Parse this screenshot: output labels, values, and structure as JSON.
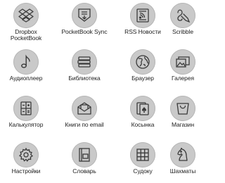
{
  "apps": [
    {
      "label": "Dropbox\nPocketBook",
      "icon": "dropbox-icon"
    },
    {
      "label": "PocketBook Sync",
      "icon": "sync-download-icon"
    },
    {
      "label": "RSS Новости",
      "icon": "rss-news-icon"
    },
    {
      "label": "Scribble",
      "icon": "scribble-icon"
    },
    {
      "label": "Аудиоплеер",
      "icon": "music-note-icon"
    },
    {
      "label": "Библиотека",
      "icon": "books-stack-icon"
    },
    {
      "label": "Браузер",
      "icon": "globe-icon"
    },
    {
      "label": "Галерея",
      "icon": "gallery-icon"
    },
    {
      "label": "Калькулятор",
      "icon": "calculator-icon"
    },
    {
      "label": "Книги по email",
      "icon": "email-book-icon"
    },
    {
      "label": "Косынка",
      "icon": "playing-cards-icon"
    },
    {
      "label": "Магазин",
      "icon": "shopping-bag-icon"
    },
    {
      "label": "Настройки",
      "icon": "gear-icon"
    },
    {
      "label": "Словарь",
      "icon": "dictionary-icon"
    },
    {
      "label": "Судоку",
      "icon": "sudoku-grid-icon"
    },
    {
      "label": "Шахматы",
      "icon": "chess-knight-icon"
    }
  ],
  "colors": {
    "circle": "#c9c9c9",
    "icon": "#3a3a3a",
    "text": "#222222"
  }
}
